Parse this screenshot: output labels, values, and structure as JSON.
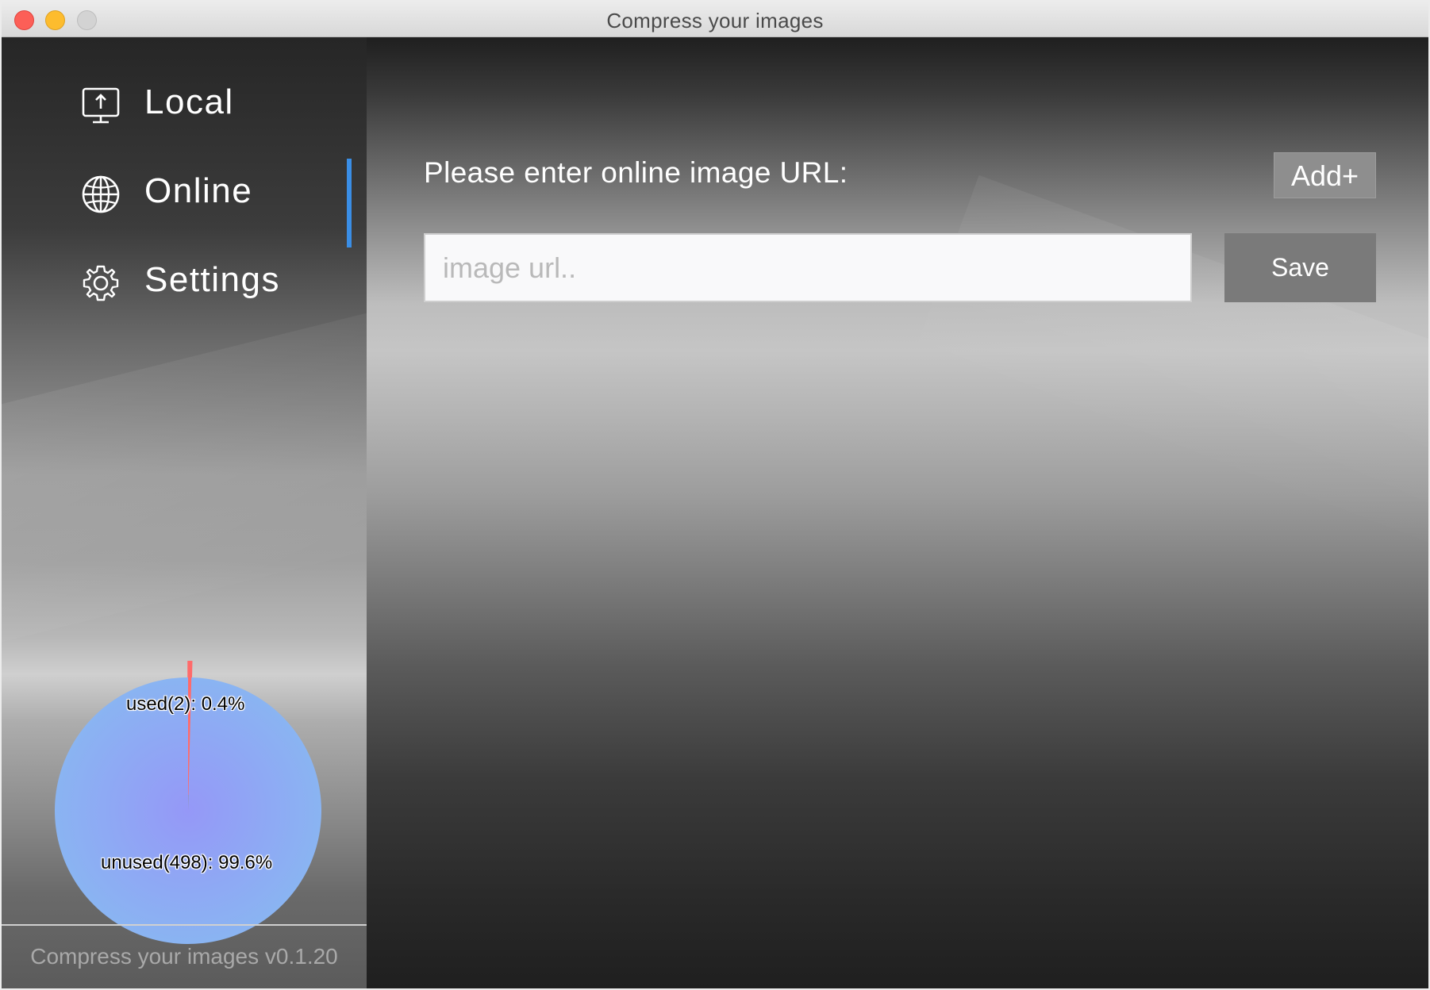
{
  "window": {
    "title": "Compress your images"
  },
  "sidebar": {
    "items": [
      {
        "label": "Local",
        "icon": "monitor-upload-icon"
      },
      {
        "label": "Online",
        "icon": "globe-icon",
        "active": true
      },
      {
        "label": "Settings",
        "icon": "gear-icon"
      }
    ],
    "version": "Compress your images v0.1.20",
    "accent_color": "#3a8ee6"
  },
  "main": {
    "prompt": "Please enter online image URL:",
    "add_label": "Add+",
    "url_input": {
      "value": "",
      "placeholder": "image url.."
    },
    "save_label": "Save"
  },
  "chart_data": {
    "type": "pie",
    "slices": [
      {
        "label": "used(2): 0.4%",
        "count": 2,
        "percent": 0.4,
        "color": "#ff6b6b"
      },
      {
        "label": "unused(498): 99.6%",
        "count": 498,
        "percent": 99.6,
        "color": "#8ab4f2"
      }
    ]
  }
}
